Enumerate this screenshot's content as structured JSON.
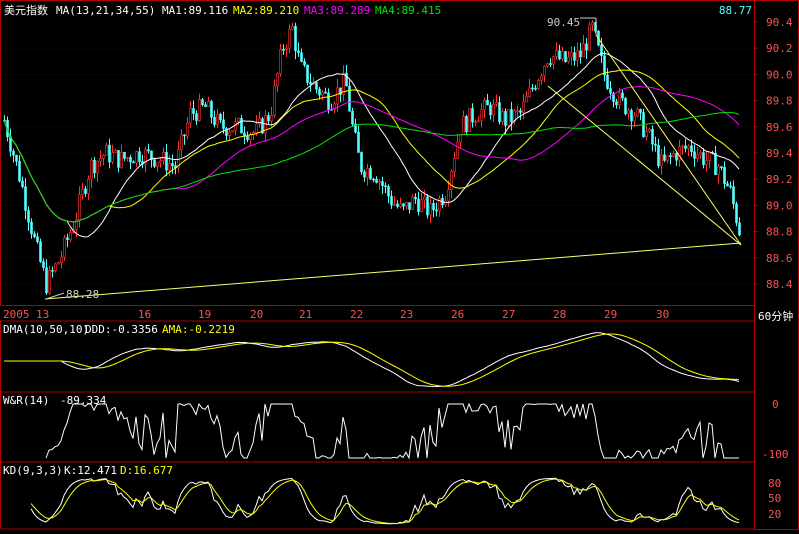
{
  "main": {
    "title": "美元指数",
    "ma_label": "MA(13,21,34,55)",
    "ma1": "MA1:89.116",
    "ma2": "MA2:89.210",
    "ma3": "MA3:89.289",
    "ma4": "MA4:89.415",
    "last_price": "88.77",
    "high_label": "90.45",
    "low_label": "88.28",
    "period": "60分钟",
    "year": "2005",
    "dates": [
      "13",
      "16",
      "19",
      "20",
      "21",
      "22",
      "23",
      "26",
      "27",
      "28",
      "29",
      "30"
    ],
    "yticks": [
      "90.4",
      "90.2",
      "90.0",
      "89.8",
      "89.6",
      "89.4",
      "89.2",
      "89.0",
      "88.8",
      "88.6",
      "88.4"
    ]
  },
  "dma": {
    "label": "DMA(10,50,10)",
    "ddd": "DDD:-0.3356",
    "ama": "AMA:-0.2219"
  },
  "wr": {
    "label": "W&R(14)",
    "value": "-89.334",
    "yticks": [
      "0",
      "-100"
    ]
  },
  "kd": {
    "label": "KD(9,3,3)",
    "k": "K:12.471",
    "d": "D:16.677",
    "yticks": [
      "80",
      "50",
      "20"
    ]
  },
  "colors": {
    "up": "#ff3232",
    "down": "#54ffff",
    "ma1": "#ffffff",
    "ma2": "#ffff00",
    "ma3": "#ff00ff",
    "ma4": "#00e600",
    "frame": "#b00000",
    "axis_text": "#ff5050",
    "trend": "#ffff66"
  },
  "chart_data": [
    {
      "type": "line",
      "title": "美元指数",
      "xlabel": "",
      "ylabel": "",
      "ylim": [
        88.22,
        90.5
      ],
      "x": [
        "2005",
        "13",
        "16",
        "19",
        "20",
        "21",
        "22",
        "23",
        "26",
        "27",
        "28",
        "29",
        "30"
      ],
      "series": [
        {
          "name": "MA1",
          "values": [
            89.6,
            88.5,
            89.2,
            89.5,
            90.0,
            89.9,
            89.2,
            88.9,
            89.6,
            90.2,
            89.9,
            89.5,
            89.2
          ]
        },
        {
          "name": "MA2",
          "values": [
            89.8,
            88.6,
            89.1,
            89.4,
            89.9,
            89.9,
            89.3,
            88.9,
            89.5,
            90.1,
            90.0,
            89.6,
            89.3
          ]
        },
        {
          "name": "MA3",
          "values": [
            89.9,
            88.9,
            89.1,
            89.3,
            89.8,
            89.9,
            89.4,
            89.0,
            89.5,
            90.0,
            90.0,
            89.7,
            89.3
          ]
        },
        {
          "name": "MA4",
          "values": [
            90.1,
            89.3,
            89.2,
            89.3,
            89.6,
            89.8,
            89.5,
            89.1,
            89.4,
            89.8,
            89.9,
            89.8,
            89.4
          ]
        }
      ],
      "annotations": [
        "90.45",
        "88.28",
        "88.77"
      ]
    },
    {
      "type": "line",
      "title": "DMA(10,50,10)",
      "series": [
        {
          "name": "DDD",
          "values": [
            -0.3356
          ]
        },
        {
          "name": "AMA",
          "values": [
            -0.2219
          ]
        }
      ]
    },
    {
      "type": "line",
      "title": "W&R(14)",
      "ylim": [
        -100,
        0
      ],
      "series": [
        {
          "values": [
            -89.334
          ]
        }
      ]
    },
    {
      "type": "line",
      "title": "KD(9,3,3)",
      "ylim": [
        0,
        100
      ],
      "series": [
        {
          "name": "K",
          "values": [
            12.471
          ]
        },
        {
          "name": "D",
          "values": [
            16.677
          ]
        }
      ]
    }
  ]
}
